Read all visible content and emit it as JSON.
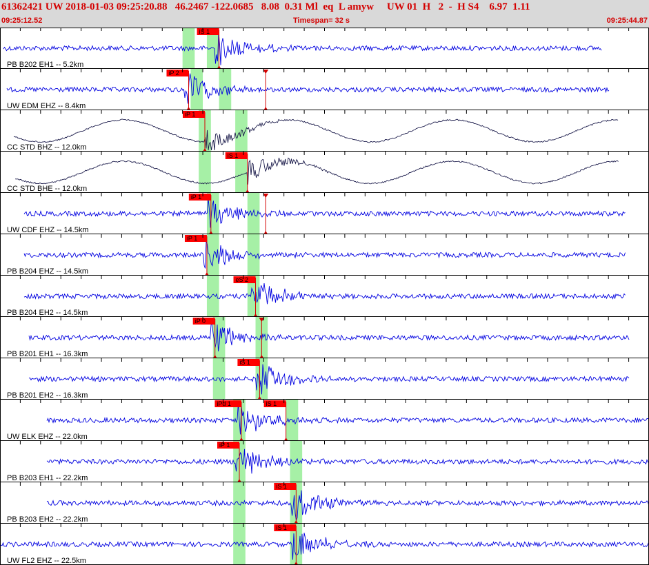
{
  "header": {
    "event_line": "61362421 UW 2018-01-03 09:25:20.88   46.2467 -122.0685   8.08  0.31 Ml  eq  L amyw     UW 01  H   2  -  H S4    6.97  1.11",
    "start_time": "09:25:12.52",
    "timespan": "Timespan=  32 s",
    "end_time": "09:25:44.87"
  },
  "colors": {
    "header_bg": "#d9d9d9",
    "header_text": "#d40000",
    "trace": "#0000e0",
    "broadband_trace": "#1a1a4a",
    "pick_window": "#a6f0a6",
    "pick_label_bg": "#ff0000"
  },
  "chart_data": {
    "type": "line",
    "title": "",
    "x_range_seconds": [
      0,
      32
    ],
    "tick_interval_seconds": 1,
    "panels": [
      {
        "label": "PB B202 EH1 -- 5.2km",
        "picks": [
          {
            "phase": "iS 1",
            "t": 10.8
          }
        ],
        "green_windows": [
          [
            9.0,
            9.6
          ],
          [
            10.2,
            10.8
          ]
        ]
      },
      {
        "label": "UW EDM EHZ -- 8.4km",
        "picks": [
          {
            "phase": "iP 2",
            "t": 9.3
          },
          {
            "phase": "",
            "t": 13.1
          }
        ],
        "green_windows": [
          [
            9.4,
            10.0
          ],
          [
            10.8,
            11.4
          ]
        ]
      },
      {
        "label": "CC STD BHZ -- 12.0km",
        "picks": [
          {
            "phase": "iP 1",
            "t": 10.1
          }
        ],
        "green_windows": [
          [
            9.8,
            10.4
          ],
          [
            11.6,
            12.2
          ]
        ]
      },
      {
        "label": "CC STD BHE -- 12.0km",
        "picks": [
          {
            "phase": "iS 1",
            "t": 12.2
          }
        ],
        "green_windows": [
          [
            9.8,
            10.4
          ],
          [
            11.6,
            12.2
          ]
        ]
      },
      {
        "label": "UW CDF EHZ -- 14.5km",
        "picks": [
          {
            "phase": "iP 1",
            "t": 10.4
          },
          {
            "phase": "",
            "t": 13.1
          }
        ],
        "green_windows": [
          [
            10.2,
            10.8
          ],
          [
            12.2,
            12.8
          ]
        ]
      },
      {
        "label": "PB B204 EHZ -- 14.5km",
        "picks": [
          {
            "phase": "iP 1",
            "t": 10.2
          }
        ],
        "green_windows": [
          [
            10.2,
            10.8
          ],
          [
            12.2,
            12.8
          ]
        ]
      },
      {
        "label": "PB B204 EH2 -- 14.5km",
        "picks": [
          {
            "phase": "eS 2",
            "t": 12.6
          }
        ],
        "green_windows": [
          [
            10.2,
            10.8
          ],
          [
            12.2,
            12.8
          ]
        ]
      },
      {
        "label": "PB B201 EH1 -- 16.3km",
        "picks": [
          {
            "phase": "iP 0",
            "t": 10.6
          },
          {
            "phase": "",
            "t": 12.9
          }
        ],
        "green_windows": [
          [
            10.5,
            11.1
          ],
          [
            12.6,
            13.2
          ]
        ]
      },
      {
        "label": "PB B201 EH2 -- 16.3km",
        "picks": [
          {
            "phase": "iS 1",
            "t": 12.8
          }
        ],
        "green_windows": [
          [
            10.5,
            11.1
          ],
          [
            12.6,
            13.2
          ]
        ]
      },
      {
        "label": "UW ELK EHZ -- 22.0km",
        "picks": [
          {
            "phase": "iPd 1",
            "t": 11.9
          },
          {
            "phase": "iS 1",
            "t": 14.1
          }
        ],
        "green_windows": [
          [
            11.5,
            12.1
          ],
          [
            14.1,
            14.7
          ]
        ]
      },
      {
        "label": "PB B203 EH1 -- 22.2km",
        "picks": [
          {
            "phase": "iP 1",
            "t": 11.8
          }
        ],
        "green_windows": [
          [
            11.5,
            12.1
          ],
          [
            14.3,
            14.9
          ]
        ]
      },
      {
        "label": "PB B203 EH2 -- 22.2km",
        "picks": [
          {
            "phase": "iS 1",
            "t": 14.6
          }
        ],
        "green_windows": [
          [
            11.5,
            12.1
          ],
          [
            14.3,
            14.9
          ]
        ]
      },
      {
        "label": "UW FL2 EHZ -- 22.5km",
        "picks": [
          {
            "phase": "iS 1",
            "t": 14.6
          }
        ],
        "green_windows": [
          [
            11.5,
            12.1
          ],
          [
            14.3,
            14.9
          ]
        ]
      }
    ]
  }
}
